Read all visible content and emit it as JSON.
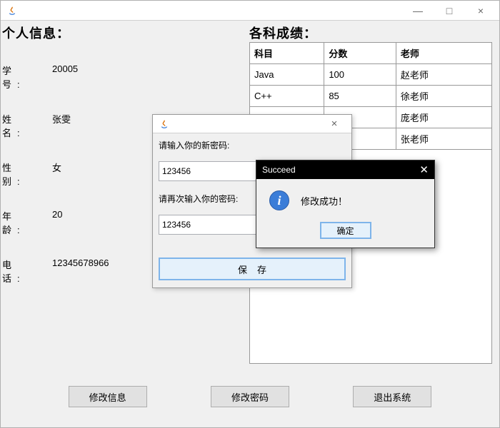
{
  "window": {
    "title": "",
    "controls": {
      "min": "—",
      "max": "□",
      "close": "×"
    }
  },
  "personal": {
    "title": "个人信息：",
    "rows": [
      {
        "label": "学　号:",
        "value": "20005"
      },
      {
        "label": "姓　名:",
        "value": "张雯"
      },
      {
        "label": "性　别:",
        "value": "女"
      },
      {
        "label": "年　龄:",
        "value": "20"
      },
      {
        "label": "电　话:",
        "value": "12345678966"
      }
    ]
  },
  "grades": {
    "title": "各科成绩：",
    "headers": [
      "科目",
      "分数",
      "老师"
    ],
    "rows": [
      [
        "Java",
        "100",
        "赵老师"
      ],
      [
        "C++",
        "85",
        "徐老师"
      ],
      [
        "",
        "",
        "庞老师"
      ],
      [
        "",
        "",
        "张老师"
      ]
    ]
  },
  "buttons": {
    "modify_info": "修改信息",
    "modify_pwd": "修改密码",
    "exit": "退出系统"
  },
  "pwd_dialog": {
    "label1": "请输入你的新密码:",
    "value1": "123456",
    "label2": "请再次输入你的密码:",
    "value2": "123456",
    "save": "保存",
    "close": "×"
  },
  "succeed_dialog": {
    "title": "Succeed",
    "message": "修改成功！",
    "ok": "确定",
    "close": "✕"
  }
}
